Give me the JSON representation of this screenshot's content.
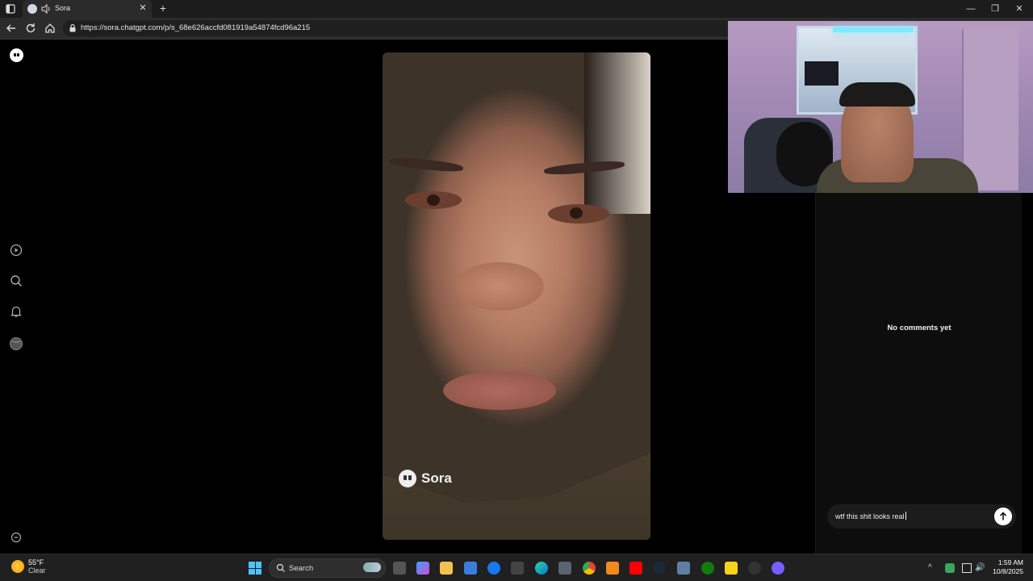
{
  "browser": {
    "tab_title": "Sora",
    "url": "https://sora.chatgpt.com/p/s_68e626accfd081919a54874fcd96a215"
  },
  "video": {
    "watermark": "Sora"
  },
  "comments": {
    "empty_text": "No comments yet",
    "input_value": "wtf this shit looks real"
  },
  "taskbar": {
    "weather_temp": "55°F",
    "weather_condition": "Clear",
    "search_label": "Search",
    "time": "1:59 AM",
    "date": "10/8/2025",
    "apps": [
      "widgets-icon",
      "task-view-icon",
      "copilot-icon",
      "file-explorer-icon",
      "store-icon",
      "facebook-icon",
      "amazon-icon",
      "edge-icon",
      "calculator-icon",
      "chrome-icon",
      "vlc-icon",
      "youtube-icon",
      "steam-icon",
      "settings-icon",
      "xbox-icon",
      "sticky-notes-icon",
      "chatgpt-icon",
      "cortana-icon"
    ]
  },
  "colors": {
    "accent": "#4cc2ff",
    "page_bg": "#000000",
    "panel_bg": "#0d0d0d"
  }
}
